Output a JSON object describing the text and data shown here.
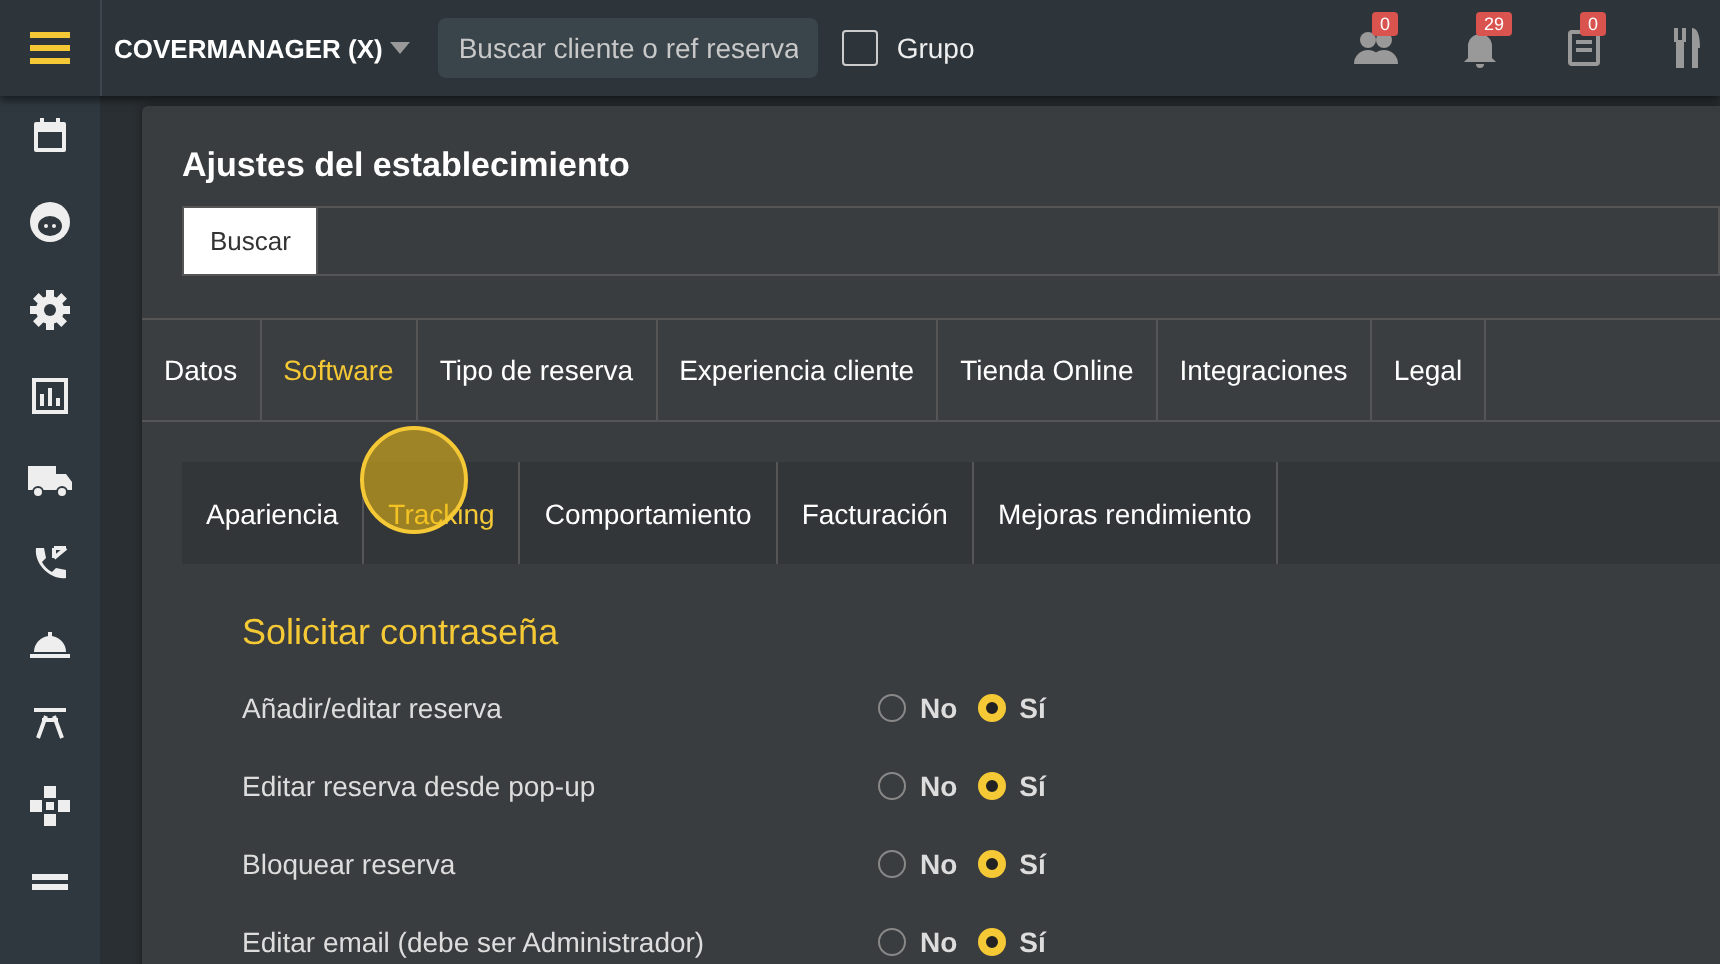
{
  "topbar": {
    "venue": "COVERMANAGER (X)",
    "search": {
      "placeholder": "Buscar cliente o ref reserva"
    },
    "group_checkbox": {
      "label": "Grupo",
      "checked": false
    },
    "notifications": [
      {
        "kind": "people",
        "count": "0"
      },
      {
        "kind": "bell",
        "count": "29"
      },
      {
        "kind": "notes",
        "count": "0"
      },
      {
        "kind": "cutlery"
      }
    ]
  },
  "sidebar": {
    "items": [
      {
        "kind": "calendar"
      },
      {
        "kind": "face"
      },
      {
        "kind": "gear"
      },
      {
        "kind": "chart"
      },
      {
        "kind": "truck"
      },
      {
        "kind": "phone"
      },
      {
        "kind": "cloche"
      },
      {
        "kind": "table"
      },
      {
        "kind": "puzzle"
      },
      {
        "kind": "list"
      }
    ]
  },
  "panel": {
    "title": "Ajustes del establecimiento",
    "search_button": "Buscar",
    "tabs": [
      {
        "label": "Datos",
        "selected": false
      },
      {
        "label": "Software",
        "selected": true
      },
      {
        "label": "Tipo de reserva",
        "selected": false
      },
      {
        "label": "Experiencia cliente",
        "selected": false
      },
      {
        "label": "Tienda Online",
        "selected": false
      },
      {
        "label": "Integraciones",
        "selected": false
      },
      {
        "label": "Legal",
        "selected": false
      }
    ],
    "subtabs": [
      {
        "label": "Apariencia",
        "selected": false
      },
      {
        "label": "Tracking",
        "selected": true
      },
      {
        "label": "Comportamiento",
        "selected": false
      },
      {
        "label": "Facturación",
        "selected": false
      },
      {
        "label": "Mejoras rendimiento",
        "selected": false
      }
    ],
    "section_title": "Solicitar contraseña",
    "settings": [
      {
        "label": "Añadir/editar reserva",
        "options": [
          {
            "label": "No",
            "selected": false
          },
          {
            "label": "Sí",
            "selected": true
          }
        ]
      },
      {
        "label": "Editar reserva desde pop-up",
        "options": [
          {
            "label": "No",
            "selected": false
          },
          {
            "label": "Sí",
            "selected": true
          }
        ]
      },
      {
        "label": "Bloquear reserva",
        "options": [
          {
            "label": "No",
            "selected": false
          },
          {
            "label": "Sí",
            "selected": true
          }
        ]
      },
      {
        "label": "Editar email (debe ser Administrador)",
        "options": [
          {
            "label": "No",
            "selected": false
          },
          {
            "label": "Sí",
            "selected": true
          }
        ]
      }
    ]
  }
}
